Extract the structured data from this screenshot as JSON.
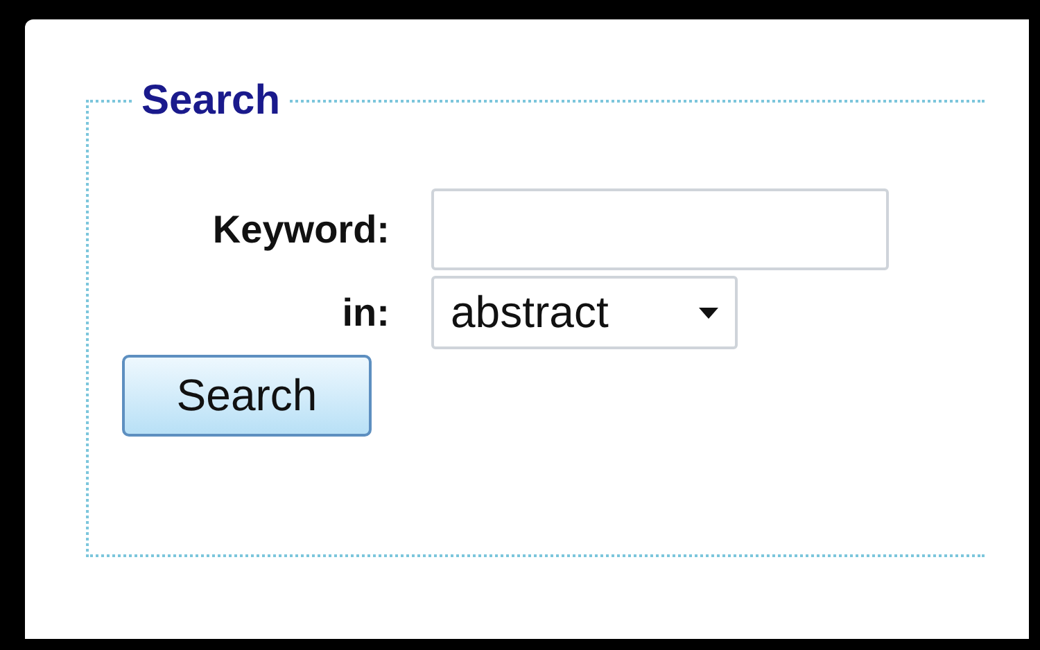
{
  "search_panel": {
    "legend": "Search",
    "fields": [
      {
        "kind": "text",
        "label": "Keyword:"
      },
      {
        "kind": "select",
        "label": "in:",
        "value": "abstract"
      }
    ],
    "button": "Search"
  }
}
